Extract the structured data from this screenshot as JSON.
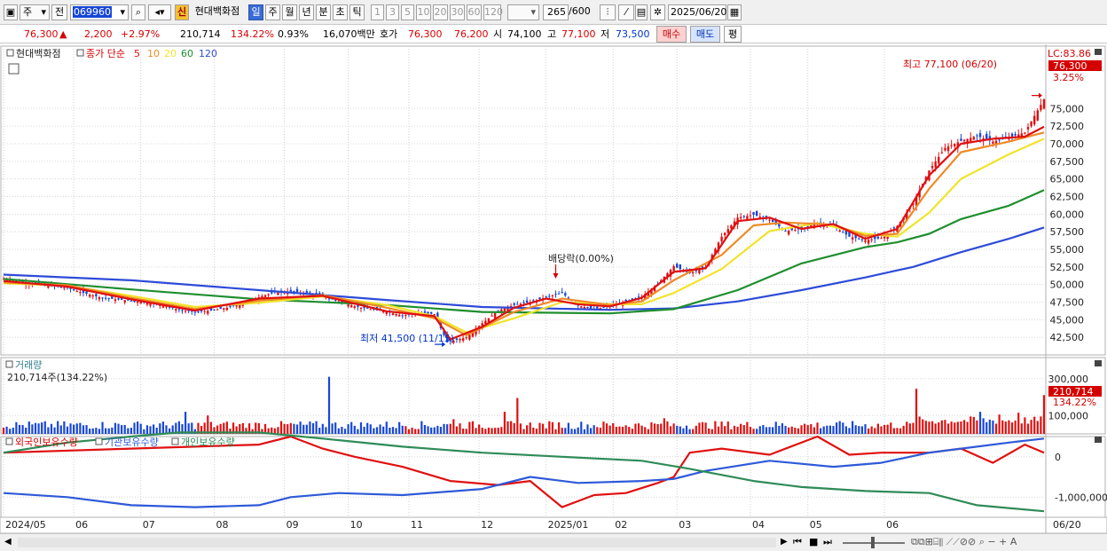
{
  "toolbar": {
    "type_label": "주",
    "prev_label": "전",
    "code": "069960",
    "sin_badge": "신",
    "stock_name": "현대백화점",
    "periods": [
      "일",
      "주",
      "월",
      "년",
      "분",
      "초",
      "틱"
    ],
    "selected_period": "일",
    "intervals": [
      "1",
      "3",
      "5",
      "10",
      "20",
      "30",
      "60",
      "120"
    ],
    "count": "265",
    "count_max": "/600",
    "date": "2025/06/20"
  },
  "quote": {
    "price": "76,300",
    "change_symbol": "▲",
    "change": "2,200",
    "change_pct": "+2.97%",
    "volume": "210,714",
    "volume_ratio": "134.22%",
    "turnover": "0.93%",
    "amount": "16,070백만",
    "hoga_label": "호가",
    "ask": "76,300",
    "bid": "76,200",
    "open_label": "시",
    "open": "74,100",
    "high_label": "고",
    "high": "77,100",
    "low_label": "저",
    "low": "73,500",
    "buy_label": "매수",
    "sell_label": "매도",
    "avg_label": "평"
  },
  "price_pane": {
    "title_name": "현대백화점",
    "ma_title": "종가 단순",
    "ma_labels": [
      "5",
      "10",
      "20",
      "60",
      "120"
    ],
    "ma_colors": [
      "#e01010",
      "#f08a24",
      "#f2e32a",
      "#1e8e2e",
      "#2e4bd8"
    ],
    "lc_label": "LC:83.86",
    "last_price_tag": "76,300",
    "last_pct_tag": "3.25%",
    "high_annotation": "최고 77,100 (06/20)",
    "low_annotation": "최저 41,500 (11/15)",
    "dividend_annotation": "배당락(0.00%)"
  },
  "volume_pane": {
    "title": "거래량",
    "value_text": "210,714주(134.22%)",
    "last_tag": "210,714",
    "last_pct": "134.22%"
  },
  "holding_pane": {
    "legend": [
      "외국인보유수량",
      "기관보유수량",
      "개인보유수량"
    ],
    "colors": [
      "#e01010",
      "#2e5ad8",
      "#2e8b57"
    ]
  },
  "x_axis": {
    "labels": [
      "2024/05",
      "06",
      "07",
      "08",
      "09",
      "10",
      "11",
      "12",
      "2025/01",
      "02",
      "03",
      "04",
      "05",
      "06"
    ],
    "right_label": "06/20"
  },
  "chart_data": [
    {
      "type": "candlestick",
      "ylim": [
        40000,
        83860
      ],
      "yticks": [
        42500,
        45000,
        47500,
        50000,
        52500,
        55000,
        57500,
        60000,
        62500,
        65000,
        67500,
        70000,
        72500,
        75000
      ],
      "ytick_labels": [
        "42,500",
        "45,000",
        "47,500",
        "50,000",
        "52,500",
        "55,000",
        "57,500",
        "60,000",
        "62,500",
        "65,000",
        "67,500",
        "70,000",
        "72,500",
        "75,000"
      ],
      "close_path": [
        [
          0,
          50800
        ],
        [
          5,
          50400
        ],
        [
          10,
          50100
        ],
        [
          15,
          49800
        ],
        [
          20,
          49500
        ],
        [
          25,
          48800
        ],
        [
          30,
          48200
        ],
        [
          35,
          47900
        ],
        [
          40,
          47700
        ],
        [
          45,
          47400
        ],
        [
          50,
          47000
        ],
        [
          55,
          46400
        ],
        [
          60,
          46100
        ],
        [
          65,
          46300
        ],
        [
          70,
          46700
        ],
        [
          75,
          47300
        ],
        [
          80,
          48200
        ],
        [
          85,
          48900
        ],
        [
          90,
          49000
        ],
        [
          95,
          48800
        ],
        [
          100,
          48300
        ],
        [
          105,
          47600
        ],
        [
          110,
          46900
        ],
        [
          115,
          46500
        ],
        [
          120,
          46100
        ],
        [
          125,
          45600
        ],
        [
          130,
          46000
        ],
        [
          135,
          45800
        ],
        [
          139,
          41800
        ],
        [
          145,
          42500
        ],
        [
          150,
          44500
        ],
        [
          155,
          46300
        ],
        [
          160,
          47100
        ],
        [
          165,
          47500
        ],
        [
          170,
          48200
        ],
        [
          175,
          48800
        ],
        [
          180,
          47000
        ],
        [
          185,
          46500
        ],
        [
          190,
          47000
        ],
        [
          195,
          47500
        ],
        [
          200,
          48300
        ],
        [
          205,
          50100
        ],
        [
          210,
          52600
        ],
        [
          215,
          51600
        ],
        [
          220,
          52500
        ],
        [
          225,
          56800
        ],
        [
          230,
          59500
        ],
        [
          235,
          59900
        ],
        [
          240,
          59200
        ],
        [
          245,
          57600
        ],
        [
          250,
          57900
        ],
        [
          255,
          58800
        ],
        [
          260,
          58300
        ],
        [
          265,
          56800
        ],
        [
          270,
          56300
        ],
        [
          275,
          56600
        ],
        [
          280,
          58300
        ],
        [
          285,
          61500
        ],
        [
          290,
          66200
        ],
        [
          295,
          69400
        ],
        [
          300,
          70400
        ],
        [
          305,
          71100
        ],
        [
          310,
          70300
        ],
        [
          315,
          70900
        ],
        [
          320,
          71600
        ],
        [
          326,
          76300
        ]
      ],
      "ma5": [
        [
          0,
          50500
        ],
        [
          20,
          49700
        ],
        [
          40,
          47900
        ],
        [
          60,
          46300
        ],
        [
          80,
          48000
        ],
        [
          100,
          48400
        ],
        [
          120,
          46200
        ],
        [
          135,
          45500
        ],
        [
          140,
          42200
        ],
        [
          150,
          44000
        ],
        [
          160,
          46700
        ],
        [
          170,
          48000
        ],
        [
          180,
          47200
        ],
        [
          190,
          46900
        ],
        [
          200,
          48100
        ],
        [
          210,
          51800
        ],
        [
          220,
          52300
        ],
        [
          230,
          59000
        ],
        [
          240,
          59500
        ],
        [
          250,
          57900
        ],
        [
          260,
          58600
        ],
        [
          270,
          56500
        ],
        [
          280,
          57900
        ],
        [
          290,
          65500
        ],
        [
          300,
          70000
        ],
        [
          310,
          70700
        ],
        [
          320,
          71000
        ],
        [
          326,
          72400
        ]
      ],
      "ma10": [
        [
          0,
          50300
        ],
        [
          20,
          49900
        ],
        [
          40,
          48100
        ],
        [
          60,
          46500
        ],
        [
          80,
          47700
        ],
        [
          100,
          48500
        ],
        [
          120,
          46700
        ],
        [
          135,
          45200
        ],
        [
          145,
          42800
        ],
        [
          160,
          46100
        ],
        [
          175,
          48000
        ],
        [
          190,
          47100
        ],
        [
          200,
          47600
        ],
        [
          210,
          50600
        ],
        [
          225,
          54200
        ],
        [
          235,
          58400
        ],
        [
          245,
          58800
        ],
        [
          260,
          58500
        ],
        [
          270,
          56900
        ],
        [
          280,
          57200
        ],
        [
          290,
          63600
        ],
        [
          300,
          68800
        ],
        [
          315,
          70300
        ],
        [
          326,
          71600
        ]
      ],
      "ma20": [
        [
          0,
          50200
        ],
        [
          20,
          49800
        ],
        [
          40,
          48400
        ],
        [
          60,
          46800
        ],
        [
          80,
          47400
        ],
        [
          100,
          48300
        ],
        [
          120,
          47100
        ],
        [
          135,
          45500
        ],
        [
          145,
          43200
        ],
        [
          160,
          45200
        ],
        [
          175,
          47500
        ],
        [
          190,
          47200
        ],
        [
          200,
          47200
        ],
        [
          210,
          48800
        ],
        [
          225,
          52200
        ],
        [
          240,
          57600
        ],
        [
          255,
          58700
        ],
        [
          270,
          57200
        ],
        [
          280,
          56800
        ],
        [
          290,
          60200
        ],
        [
          300,
          65000
        ],
        [
          315,
          68500
        ],
        [
          326,
          70700
        ]
      ],
      "ma60": [
        [
          0,
          50800
        ],
        [
          40,
          49300
        ],
        [
          80,
          47900
        ],
        [
          120,
          47100
        ],
        [
          150,
          46100
        ],
        [
          190,
          45900
        ],
        [
          210,
          46500
        ],
        [
          230,
          49200
        ],
        [
          250,
          53000
        ],
        [
          270,
          55300
        ],
        [
          280,
          56000
        ],
        [
          290,
          57200
        ],
        [
          300,
          59300
        ],
        [
          315,
          61200
        ],
        [
          326,
          63400
        ]
      ],
      "ma120": [
        [
          0,
          51400
        ],
        [
          40,
          50600
        ],
        [
          80,
          49200
        ],
        [
          120,
          47800
        ],
        [
          150,
          46800
        ],
        [
          190,
          46400
        ],
        [
          210,
          46600
        ],
        [
          230,
          47600
        ],
        [
          250,
          49200
        ],
        [
          270,
          51000
        ],
        [
          285,
          52500
        ],
        [
          300,
          54600
        ],
        [
          315,
          56500
        ],
        [
          326,
          58100
        ]
      ]
    },
    {
      "type": "bar",
      "title": "거래량",
      "ylim": [
        0,
        400000
      ],
      "yticks": [
        100000,
        300000
      ],
      "ytick_labels": [
        "100,000",
        "300,000"
      ],
      "spikes": [
        [
          102,
          310000
        ],
        [
          57,
          120000
        ],
        [
          64,
          100000
        ],
        [
          157,
          120000
        ],
        [
          161,
          195000
        ],
        [
          141,
          80000
        ],
        [
          207,
          85000
        ],
        [
          286,
          245000
        ],
        [
          306,
          120000
        ],
        [
          312,
          105000
        ],
        [
          318,
          115000
        ],
        [
          326,
          210714
        ]
      ]
    },
    {
      "type": "line",
      "title": "보유수량",
      "ylim": [
        -1500000,
        500000
      ],
      "yticks": [
        0,
        -1000000
      ],
      "ytick_labels": [
        "0",
        "-1,000,000"
      ],
      "series": [
        {
          "name": "외국인보유수량",
          "points": [
            [
              0,
              100000
            ],
            [
              40,
              200000
            ],
            [
              80,
              300000
            ],
            [
              90,
              500000
            ],
            [
              100,
              200000
            ],
            [
              110,
              0
            ],
            [
              125,
              -250000
            ],
            [
              140,
              -600000
            ],
            [
              155,
              -700000
            ],
            [
              165,
              -600000
            ],
            [
              175,
              -1250000
            ],
            [
              185,
              -950000
            ],
            [
              195,
              -900000
            ],
            [
              205,
              -650000
            ],
            [
              210,
              -500000
            ],
            [
              215,
              100000
            ],
            [
              225,
              200000
            ],
            [
              240,
              50000
            ],
            [
              255,
              500000
            ],
            [
              265,
              50000
            ],
            [
              275,
              100000
            ],
            [
              290,
              100000
            ],
            [
              300,
              200000
            ],
            [
              310,
              -150000
            ],
            [
              320,
              300000
            ],
            [
              326,
              100000
            ]
          ]
        },
        {
          "name": "기관보유수량",
          "points": [
            [
              0,
              -900000
            ],
            [
              20,
              -1000000
            ],
            [
              40,
              -1200000
            ],
            [
              60,
              -1250000
            ],
            [
              80,
              -1200000
            ],
            [
              90,
              -1000000
            ],
            [
              105,
              -900000
            ],
            [
              125,
              -950000
            ],
            [
              150,
              -800000
            ],
            [
              165,
              -500000
            ],
            [
              180,
              -650000
            ],
            [
              200,
              -600000
            ],
            [
              210,
              -550000
            ],
            [
              220,
              -350000
            ],
            [
              240,
              -100000
            ],
            [
              260,
              -250000
            ],
            [
              275,
              -150000
            ],
            [
              290,
              100000
            ],
            [
              305,
              250000
            ],
            [
              315,
              350000
            ],
            [
              326,
              450000
            ]
          ]
        },
        {
          "name": "개인보유수량",
          "points": [
            [
              0,
              100000
            ],
            [
              20,
              350000
            ],
            [
              40,
              500000
            ],
            [
              55,
              600000
            ],
            [
              80,
              600000
            ],
            [
              100,
              450000
            ],
            [
              125,
              250000
            ],
            [
              150,
              100000
            ],
            [
              175,
              0
            ],
            [
              200,
              -100000
            ],
            [
              215,
              -300000
            ],
            [
              235,
              -600000
            ],
            [
              250,
              -750000
            ],
            [
              270,
              -850000
            ],
            [
              290,
              -900000
            ],
            [
              305,
              -1200000
            ],
            [
              326,
              -1350000
            ]
          ]
        }
      ]
    }
  ]
}
